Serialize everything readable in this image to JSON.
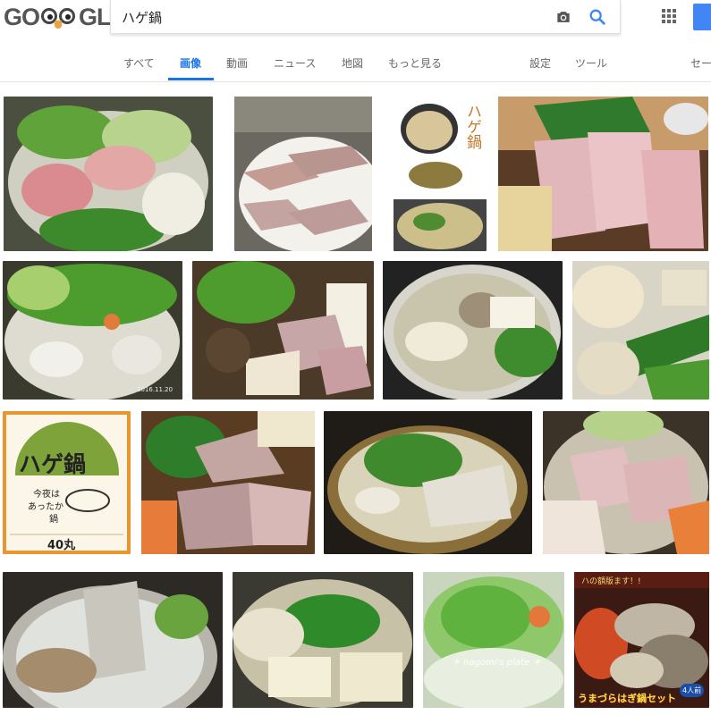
{
  "logo": {
    "text": "GO  GLE"
  },
  "search": {
    "query": "ハゲ鍋"
  },
  "tabs": [
    {
      "label": "すべて"
    },
    {
      "label": "画像"
    },
    {
      "label": "動画"
    },
    {
      "label": "ニュース"
    },
    {
      "label": "地図"
    },
    {
      "label": "もっと見る"
    },
    {
      "label": "設定"
    },
    {
      "label": "ツール"
    },
    {
      "label": "セー"
    }
  ],
  "images": {
    "hage_nabe_small_label": "ハゲ鍋",
    "sign_title": "ハゲ鍋",
    "sign_sub1": "今夜は",
    "sign_sub2": "あったか",
    "sign_sub3": "鍋",
    "sign_bottom": "40丸",
    "stamp_date": "2016.11.20",
    "watermark": "＊ nagomi's plate ＊",
    "banner_top": "ハの額版ます！!",
    "banner_bottom": "うまづらはぎ鍋セット",
    "banner_badge": "4人前"
  },
  "colors": {
    "accent": "#1a73e8",
    "brand_blue": "#4285f4"
  }
}
